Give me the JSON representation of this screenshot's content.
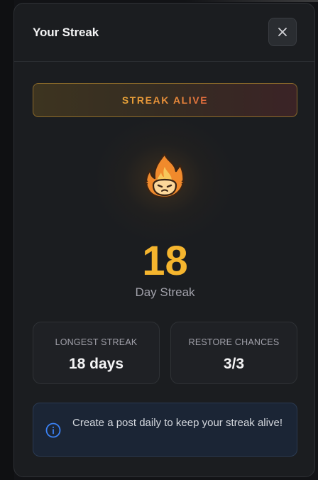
{
  "modal": {
    "title": "Your Streak",
    "close_icon": "close-icon"
  },
  "status": {
    "label": "STREAK ALIVE"
  },
  "streak": {
    "icon": "fire-icon",
    "count": "18",
    "label": "Day Streak"
  },
  "stats": [
    {
      "label": "LONGEST STREAK",
      "value": "18 days"
    },
    {
      "label": "RESTORE CHANCES",
      "value": "3/3"
    }
  ],
  "info": {
    "icon": "info-icon",
    "text": "Create a post daily to keep your streak alive!"
  },
  "colors": {
    "accent": "#f5b52e",
    "info_blue": "#3b82f6"
  }
}
